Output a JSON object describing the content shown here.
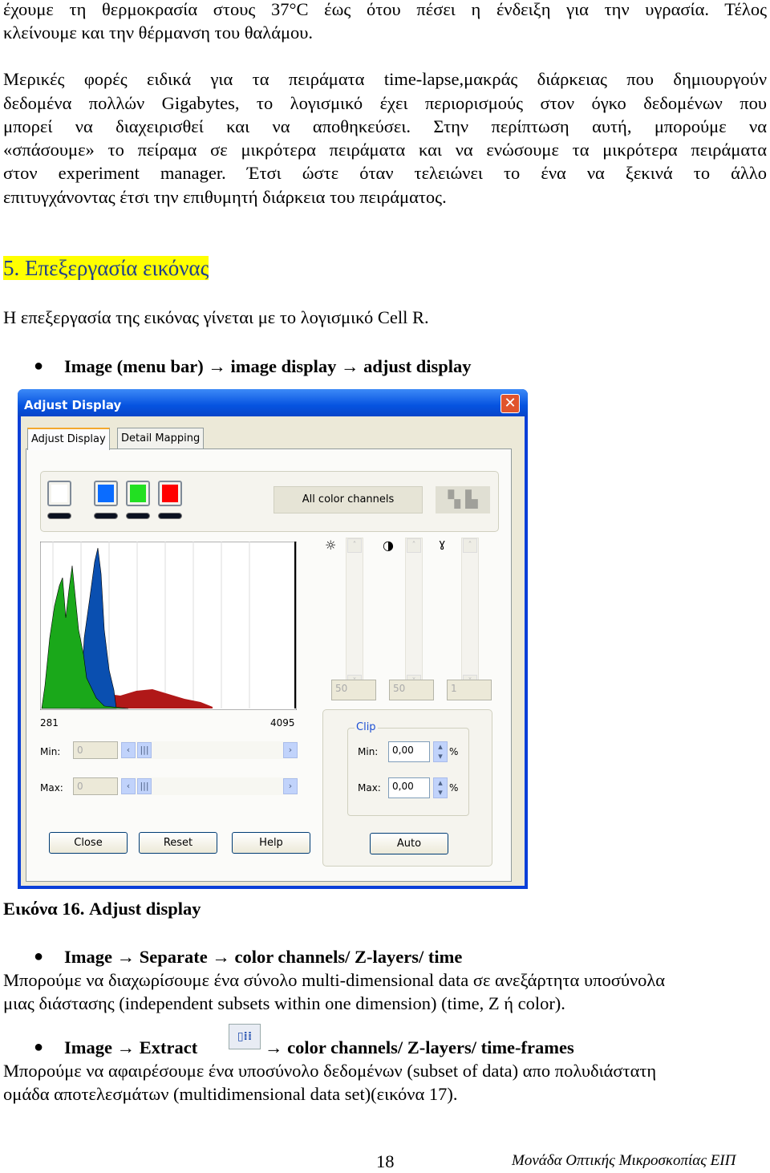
{
  "top_paragraph": [
    "έχουμε τη θερμοκρασία στους 37°C έως ότου πέσει η ένδειξη για την υγρασία. Τέλος",
    "κλείνουμε και την θέρμανση του θαλάμου."
  ],
  "paragraph2": [
    "Μερικές φορές ειδικά για τα πειράματα time-lapse,μακράς διάρκειας που δημιουργούν",
    "δεδομένα πολλών Gigabytes, το λογισμικό έχει περιορισμούς στον όγκο δεδομένων που",
    "μπορεί να διαχειρισθεί και να αποθηκεύσει. Στην περίπτωση αυτή, μπορούμε να",
    "«σπάσουμε» το πείραμα σε μικρότερα πειράματα και να ενώσουμε τα μικρότερα πειράματα",
    "στον experiment manager. Έτσι ώστε όταν τελειώνει το ένα να ξεκινά το άλλο",
    "επιτυγχάνοντας έτσι την επιθυμητή διάρκεια του πειράματος."
  ],
  "heading": "5. Επεξεργασία εικόνας",
  "intro": "Η επεξεργασία της εικόνας γίνεται με το λογισμικό Cell R.",
  "bullet1": "Image (menu bar) → image display → adjust display",
  "dialog": {
    "title": "Adjust Display",
    "tabs": [
      "Adjust Display",
      "Detail Mapping"
    ],
    "channel_colors": [
      "#ffffff",
      "#0a6cff",
      "#22e022",
      "#ff0000"
    ],
    "channel_select": "All color channels",
    "hist_min_label": "281",
    "hist_max_label": "4095",
    "min_label": "Min:",
    "max_label": "Max:",
    "min_value": "0",
    "max_value": "0",
    "brightness": "50",
    "contrast": "50",
    "gamma": "1",
    "clip": {
      "label": "Clip",
      "min_label": "Min:",
      "max_label": "Max:",
      "min_value": "0,00",
      "max_value": "0,00",
      "unit": "%"
    },
    "buttons": {
      "close": "Close",
      "reset": "Reset",
      "help": "Help",
      "auto": "Auto"
    }
  },
  "caption": "Εικόνα 16.  Adjust display",
  "bullet2": "Image → Separate → color channels/ Z-layers/ time",
  "paragraph3": [
    "Μπορούμε να διαχωρίσουμε ένα σύνολο multi-dimensional data σε ανεξάρτητα υποσύνολα",
    "μιας διάστασης (independent subsets within one dimension) (time, Z ή color)."
  ],
  "bullet3": {
    "left": "Image → Extract",
    "right": "→ color channels/ Z-layers/ time-frames"
  },
  "paragraph4": [
    "Μπορούμε να αφαιρέσουμε ένα υποσύνολο δεδομένων (subset of data) απο πολυδιάστατη",
    "ομάδα αποτελεσμάτων (multidimensional data set)(εικόνα 17)."
  ],
  "footer": {
    "page": "18",
    "text": "Μονάδα Οπτικής Μικροσκοπίας ΕΙΠ"
  }
}
